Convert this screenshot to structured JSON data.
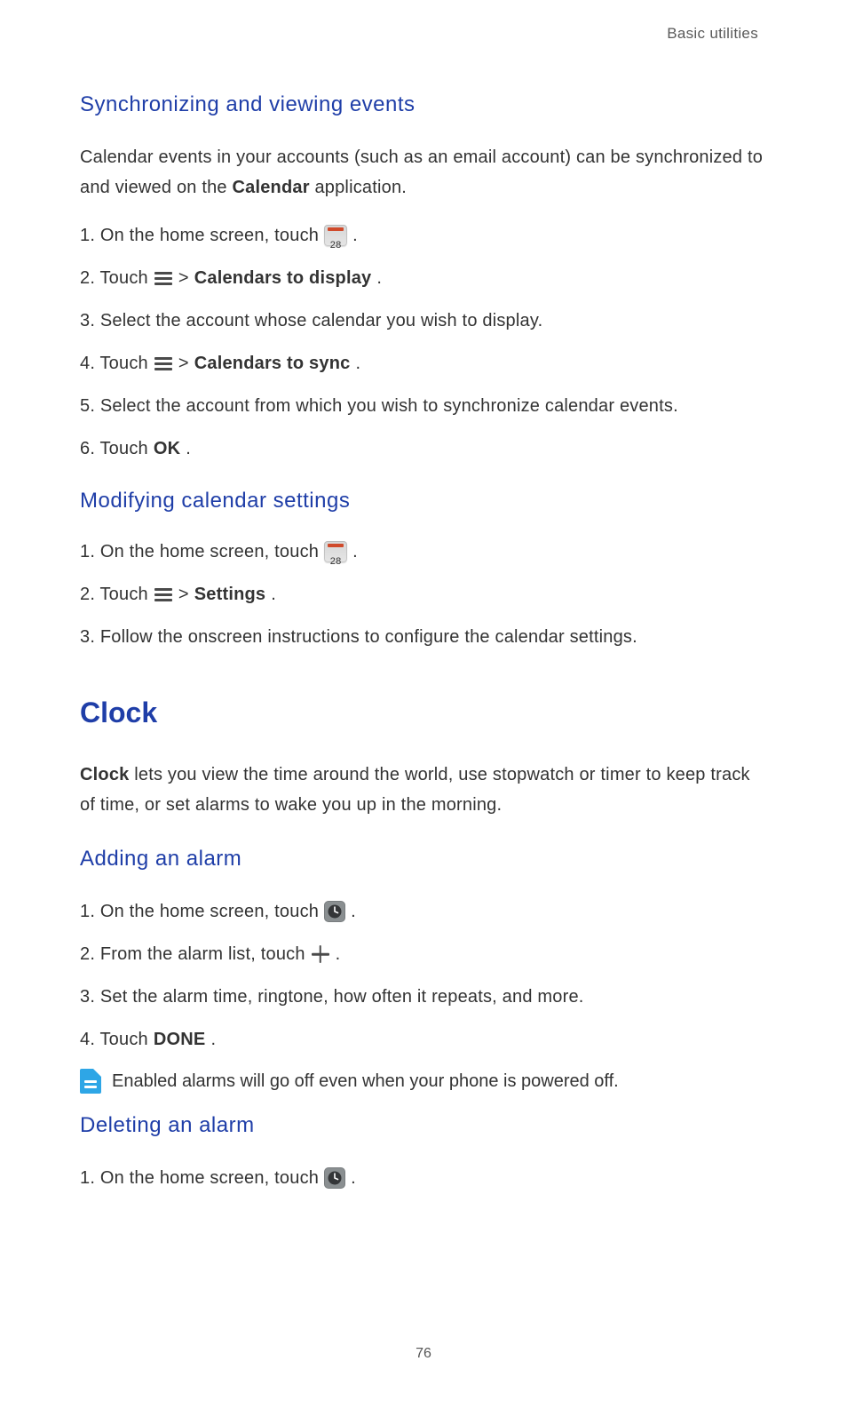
{
  "header": {
    "breadcrumb": "Basic utilities"
  },
  "calendar_icon_day": "28",
  "sections": {
    "sync": {
      "heading": "Synchronizing and viewing events",
      "intro_pre": "Calendar events in your accounts (such as an email account) can be synchronized to and viewed on the ",
      "intro_bold": "Calendar",
      "intro_post": " application.",
      "steps": {
        "s1_pre": "1. On the home screen, touch ",
        "s1_post": " .",
        "s2_pre": "2. Touch ",
        "s2_gt": " > ",
        "s2_bold": "Calendars to display",
        "s2_post": ".",
        "s3": "3. Select the account whose calendar you wish to display.",
        "s4_pre": "4. Touch ",
        "s4_gt": " > ",
        "s4_bold": "Calendars to sync",
        "s4_post": ".",
        "s5": "5. Select the account from which you wish to synchronize calendar events.",
        "s6_pre": "6. Touch ",
        "s6_bold": "OK",
        "s6_post": "."
      }
    },
    "modify": {
      "heading": "Modifying calendar settings",
      "steps": {
        "s1_pre": "1. On the home screen, touch ",
        "s1_post": " .",
        "s2_pre": "2. Touch ",
        "s2_gt": " > ",
        "s2_bold": "Settings",
        "s2_post": ".",
        "s3": "3. Follow the onscreen instructions to configure the calendar settings."
      }
    },
    "clock": {
      "heading": "Clock",
      "intro_bold": "Clock",
      "intro_post": " lets you view the time around the world, use stopwatch or timer to keep track of time, or set alarms to wake you up in the morning."
    },
    "add_alarm": {
      "heading": "Adding an alarm",
      "steps": {
        "s1_pre": "1. On the home screen, touch ",
        "s1_post": " .",
        "s2_pre": "2. From the alarm list, touch ",
        "s2_post": " .",
        "s3": "3. Set the alarm time, ringtone, how often it repeats, and more.",
        "s4_pre": "4. Touch ",
        "s4_bold": "DONE",
        "s4_post": "."
      },
      "note": "Enabled alarms will go off even when your phone is powered off."
    },
    "delete_alarm": {
      "heading": "Deleting an alarm",
      "steps": {
        "s1_pre": "1. On the home screen, touch ",
        "s1_post": " ."
      }
    }
  },
  "page_number": "76"
}
